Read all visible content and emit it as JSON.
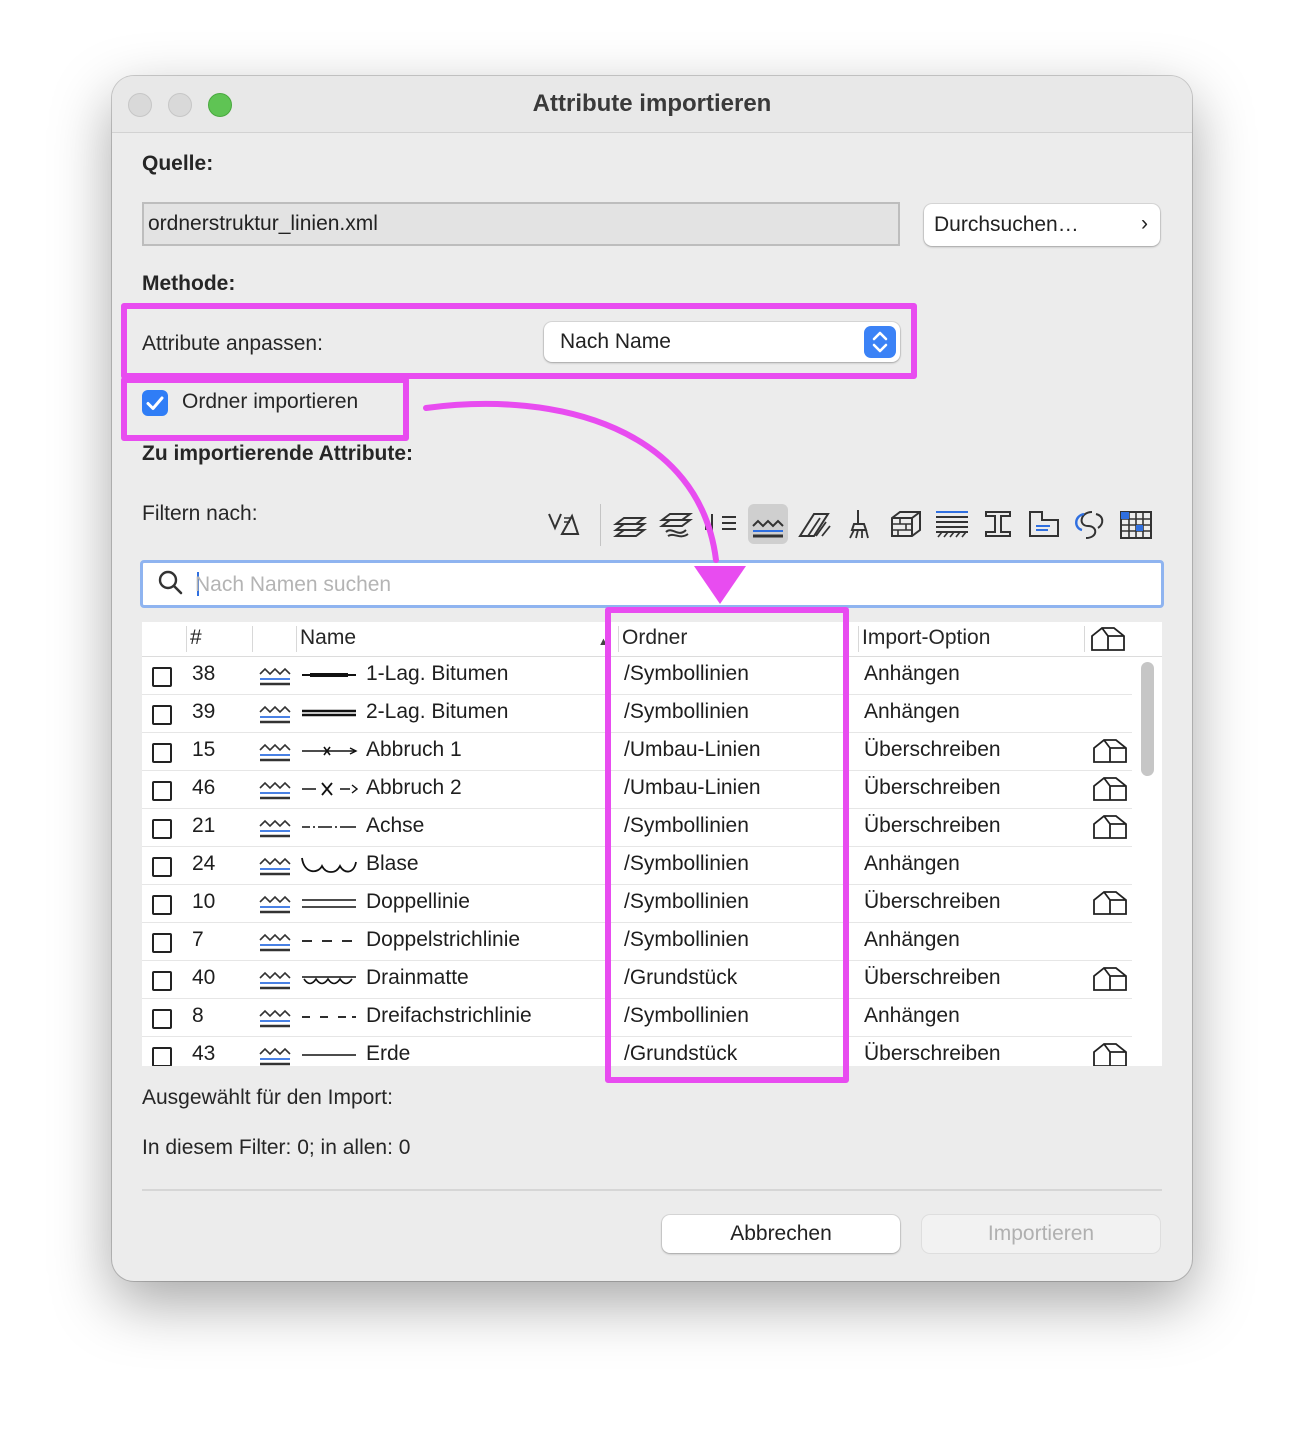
{
  "window": {
    "title": "Attribute importieren"
  },
  "source": {
    "label": "Quelle:",
    "file": "ordnerstruktur_linien.xml",
    "browse_label": "Durchsuchen…",
    "browse_chevron": "›"
  },
  "method": {
    "label": "Methode:",
    "adjust_label": "Attribute anpassen:",
    "adjust_value": "Nach Name",
    "import_folders_label": "Ordner importieren",
    "import_folders_checked": true
  },
  "attributes": {
    "label": "Zu importierende Attribute:",
    "filter_label": "Filtern nach:",
    "filter_icons": [
      "all-attributes-icon",
      "layers-icon",
      "layer-combinations-icon",
      "pens-icon",
      "line-types-icon",
      "fill-types-icon",
      "surfaces-icon",
      "building-materials-icon",
      "composite-structures-icon",
      "profiles-icon",
      "zone-categories-icon",
      "mep-systems-icon",
      "markup-styles-icon"
    ],
    "selected_filter": "line-types-icon",
    "search_placeholder": "Nach Namen suchen"
  },
  "table": {
    "headers": {
      "num": "#",
      "name": "Name",
      "folder": "Ordner",
      "import_option": "Import-Option"
    },
    "sort": "name-ascending",
    "rows": [
      {
        "num": "38",
        "name": "1-Lag. Bitumen",
        "folder": "/Symbollinien",
        "option": "Anhängen",
        "house": false,
        "line": "bitumen1"
      },
      {
        "num": "39",
        "name": "2-Lag. Bitumen",
        "folder": "/Symbollinien",
        "option": "Anhängen",
        "house": false,
        "line": "bitumen2"
      },
      {
        "num": "15",
        "name": "Abbruch 1",
        "folder": "/Umbau-Linien",
        "option": "Überschreiben",
        "house": true,
        "line": "abbruch1"
      },
      {
        "num": "46",
        "name": "Abbruch 2",
        "folder": "/Umbau-Linien",
        "option": "Überschreiben",
        "house": true,
        "line": "abbruch2"
      },
      {
        "num": "21",
        "name": "Achse",
        "folder": "/Symbollinien",
        "option": "Überschreiben",
        "house": true,
        "line": "achse"
      },
      {
        "num": "24",
        "name": "Blase",
        "folder": "/Symbollinien",
        "option": "Anhängen",
        "house": false,
        "line": "blase"
      },
      {
        "num": "10",
        "name": "Doppellinie",
        "folder": "/Symbollinien",
        "option": "Überschreiben",
        "house": true,
        "line": "doppel"
      },
      {
        "num": "7",
        "name": "Doppelstrichlinie",
        "folder": "/Symbollinien",
        "option": "Anhängen",
        "house": false,
        "line": "dash2"
      },
      {
        "num": "40",
        "name": "Drainmatte",
        "folder": "/Grundstück",
        "option": "Überschreiben",
        "house": true,
        "line": "drain"
      },
      {
        "num": "8",
        "name": "Dreifachstrichlinie",
        "folder": "/Symbollinien",
        "option": "Anhängen",
        "house": false,
        "line": "dash3"
      },
      {
        "num": "43",
        "name": "Erde",
        "folder": "/Grundstück",
        "option": "Überschreiben",
        "house": true,
        "line": "erde"
      }
    ]
  },
  "summary": {
    "selected_label": "Ausgewählt für den Import:",
    "counts": "In diesem Filter: 0; in allen: 0"
  },
  "buttons": {
    "cancel": "Abbrechen",
    "import": "Importieren",
    "import_enabled": false
  },
  "annotation_color": "#e84cf0"
}
